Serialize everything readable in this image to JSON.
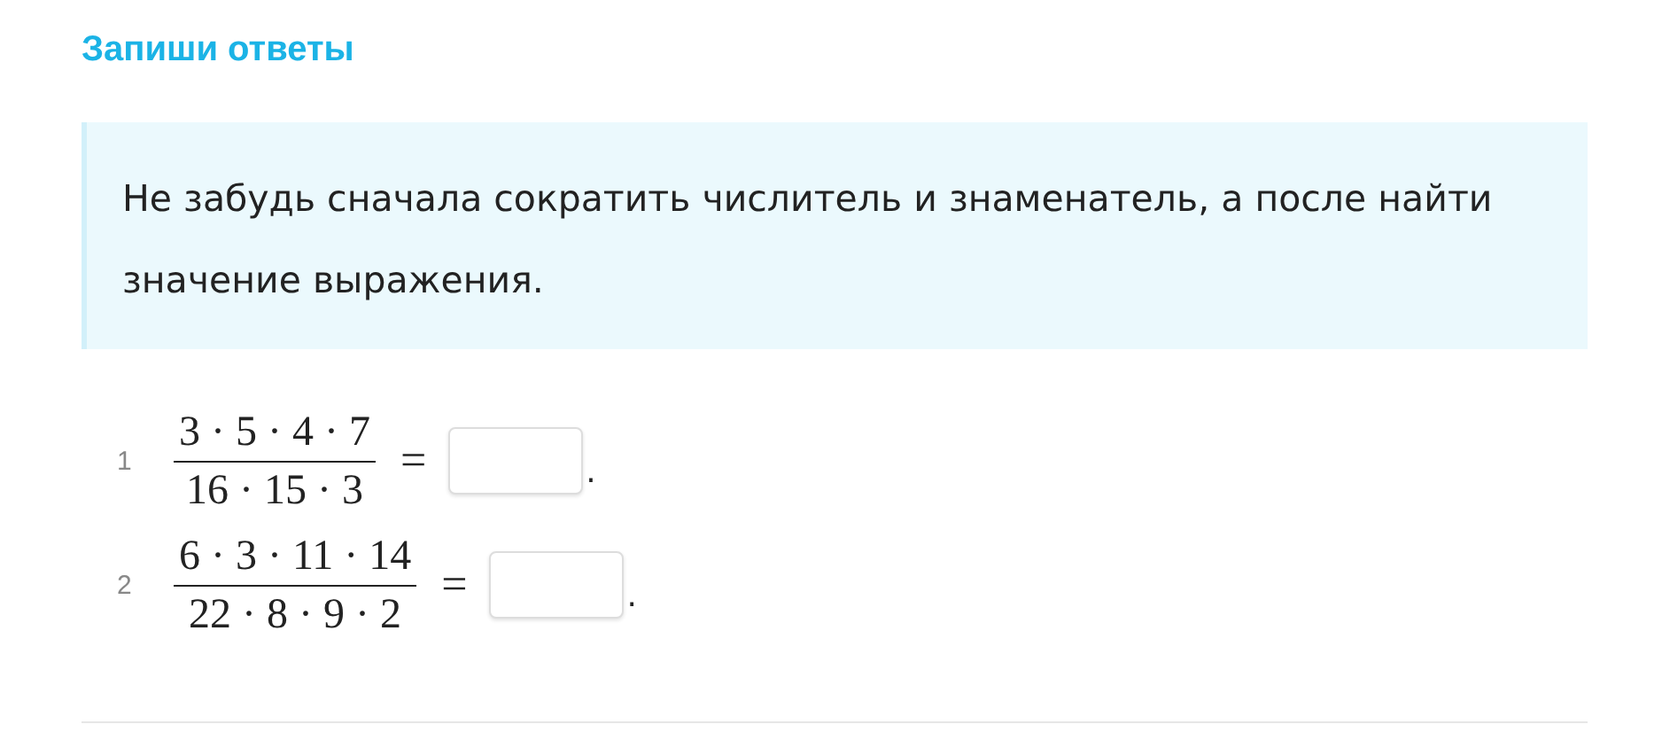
{
  "title": "Запиши ответы",
  "hint": "Не забудь сначала сократить числитель и знаменатель, а после найти значение выражения.",
  "problems": [
    {
      "number": "1",
      "numerator": "3 · 5 · 4 · 7",
      "denominator": "16 · 15 · 3",
      "sign": "=",
      "end": "."
    },
    {
      "number": "2",
      "numerator": "6 · 3 · 11 · 14",
      "denominator": "22 · 8 · 9 · 2",
      "sign": "=",
      "end": "."
    }
  ]
}
